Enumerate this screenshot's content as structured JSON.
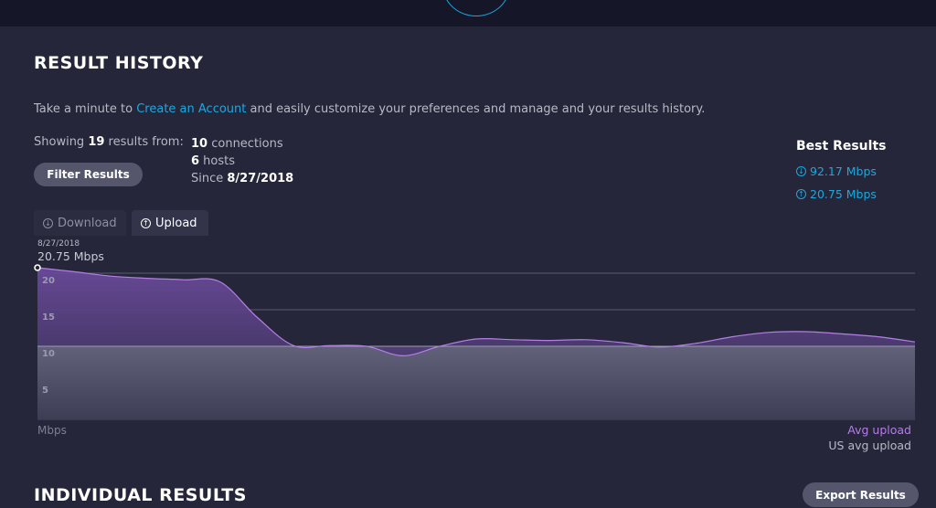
{
  "header": {
    "title": "RESULT HISTORY"
  },
  "intro": {
    "prefix": "Take a minute to ",
    "link": "Create an Account",
    "suffix": " and easily customize your preferences and manage and your results history."
  },
  "summary": {
    "showing_prefix": "Showing ",
    "count": "19",
    "showing_suffix": " results from:",
    "connections_count": "10",
    "connections_label": " connections",
    "hosts_count": "6",
    "hosts_label": " hosts",
    "since_label": "Since ",
    "since_date": "8/27/2018"
  },
  "filter_button": "Filter Results",
  "best_results": {
    "title": "Best Results",
    "download": "92.17 Mbps",
    "upload": "20.75 Mbps"
  },
  "tabs": [
    {
      "label": "Download",
      "icon": "download-icon",
      "active": false
    },
    {
      "label": "Upload",
      "icon": "upload-icon",
      "active": true
    }
  ],
  "hover": {
    "date": "8/27/2018",
    "value": "20.75 Mbps"
  },
  "chart_data": {
    "type": "area",
    "series": [
      {
        "name": "Avg upload",
        "color": "#b57ee6",
        "values": [
          20.75,
          20.2,
          19.6,
          19.3,
          19.1,
          18.8,
          14,
          10.1,
          10.1,
          10.0,
          8.7,
          10.0,
          11.0,
          10.9,
          10.8,
          10.9,
          10.5,
          9.9,
          10.4,
          11.3,
          11.9,
          12.0,
          11.7,
          11.3,
          10.6
        ]
      },
      {
        "name": "US avg upload",
        "color": "#7a7c92",
        "values": [
          10,
          10
        ]
      }
    ],
    "yticks": [
      5,
      10,
      15,
      20
    ],
    "ylim": [
      0,
      21
    ],
    "ylabel": "Mbps",
    "grid": true
  },
  "legend": {
    "avg": "Avg upload",
    "us_avg": "US avg upload"
  },
  "individual": {
    "title": "INDIVIDUAL RESULTS",
    "export_button": "Export Results"
  }
}
